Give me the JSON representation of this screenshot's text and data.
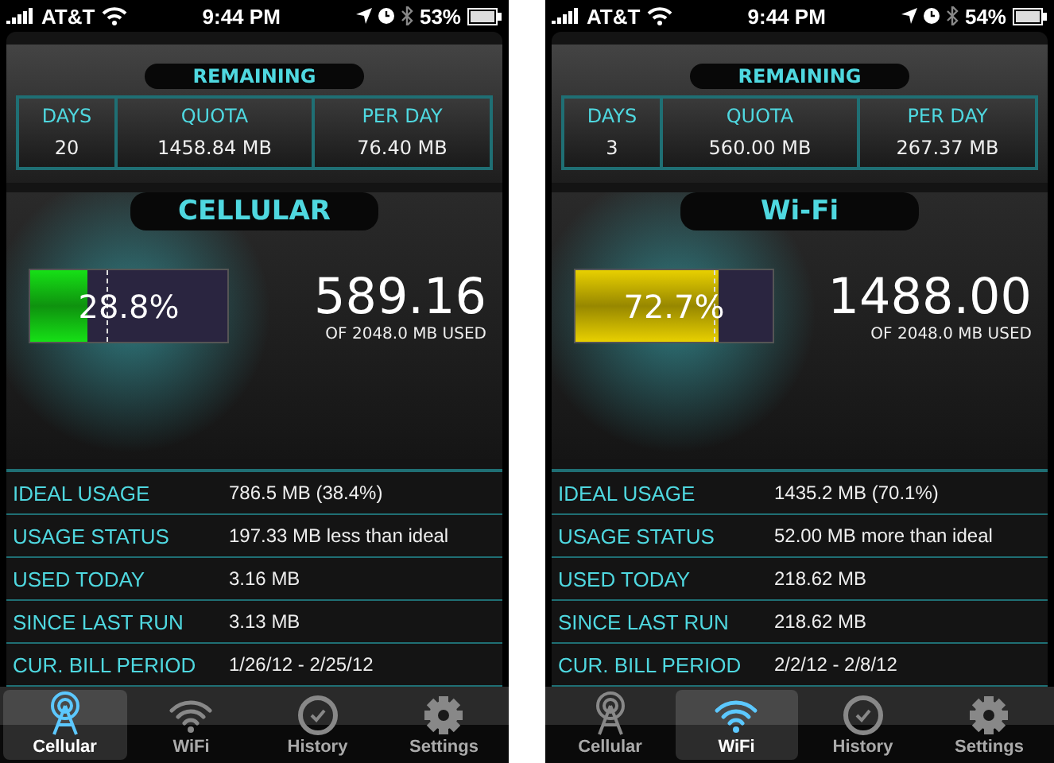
{
  "phones": [
    {
      "status_bar": {
        "carrier": "AT&T",
        "time": "9:44 PM",
        "battery": "53%"
      },
      "remaining": {
        "title": "REMAINING",
        "columns": [
          {
            "label": "DAYS",
            "value": "20"
          },
          {
            "label": "QUOTA",
            "value": "1458.84 MB"
          },
          {
            "label": "PER DAY",
            "value": "76.40 MB"
          }
        ]
      },
      "usage": {
        "title": "CELLULAR",
        "meter": {
          "level": 0.288,
          "color": "#16e016",
          "reading": "28.8%",
          "ideal_marker": {
            "level": 0.384
          }
        },
        "used": "589.16",
        "of_total": "OF 2048.0 MB USED"
      },
      "details": [
        {
          "label": "IDEAL USAGE",
          "value": "786.5 MB (38.4%)"
        },
        {
          "label": "USAGE STATUS",
          "value": "197.33 MB less than ideal"
        },
        {
          "label": "USED TODAY",
          "value": "3.16 MB"
        },
        {
          "label": "SINCE LAST RUN",
          "value": "3.13 MB"
        },
        {
          "label": "CUR. BILL PERIOD",
          "value": "1/26/12 - 2/25/12"
        }
      ],
      "tabs": [
        {
          "kind": "tower",
          "label": "Cellular",
          "selected": true
        },
        {
          "kind": "wifi",
          "label": "WiFi",
          "selected": false
        },
        {
          "kind": "clock",
          "label": "History",
          "selected": false
        },
        {
          "kind": "gear",
          "label": "Settings",
          "selected": false
        }
      ]
    },
    {
      "status_bar": {
        "carrier": "AT&T",
        "time": "9:44 PM",
        "battery": "54%"
      },
      "remaining": {
        "title": "REMAINING",
        "columns": [
          {
            "label": "DAYS",
            "value": "3"
          },
          {
            "label": "QUOTA",
            "value": "560.00 MB"
          },
          {
            "label": "PER DAY",
            "value": "267.37 MB"
          }
        ]
      },
      "usage": {
        "title": "Wi-Fi",
        "meter": {
          "level": 0.727,
          "color": "#e8d000",
          "reading": "72.7%",
          "ideal_marker": {
            "level": 0.701
          }
        },
        "used": "1488.00",
        "of_total": "OF 2048.0 MB USED"
      },
      "details": [
        {
          "label": "IDEAL USAGE",
          "value": "1435.2 MB (70.1%)"
        },
        {
          "label": "USAGE STATUS",
          "value": "52.00 MB more than ideal"
        },
        {
          "label": "USED TODAY",
          "value": "218.62 MB"
        },
        {
          "label": "SINCE LAST RUN",
          "value": "218.62 MB"
        },
        {
          "label": "CUR. BILL PERIOD",
          "value": "2/2/12 - 2/8/12"
        }
      ],
      "tabs": [
        {
          "kind": "tower",
          "label": "Cellular",
          "selected": false
        },
        {
          "kind": "wifi",
          "label": "WiFi",
          "selected": true
        },
        {
          "kind": "clock",
          "label": "History",
          "selected": false
        },
        {
          "kind": "gear",
          "label": "Settings",
          "selected": false
        }
      ]
    }
  ]
}
